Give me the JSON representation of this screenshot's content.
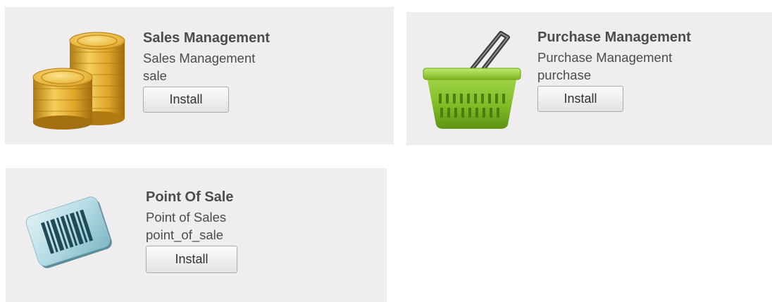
{
  "modules": [
    {
      "title": "Sales Management",
      "description": "Sales Management",
      "technical_name": "sale",
      "install_label": "Install",
      "icon": "gold-coins-icon"
    },
    {
      "title": "Purchase Management",
      "description": "Purchase Management",
      "technical_name": "purchase",
      "install_label": "Install",
      "icon": "shopping-basket-icon"
    },
    {
      "title": "Point Of Sale",
      "description": "Point of Sales",
      "technical_name": "point_of_sale",
      "install_label": "Install",
      "icon": "barcode-card-icon"
    }
  ],
  "colors": {
    "card_background": "#efedee",
    "text": "#4c4c4c",
    "basket_green": "#8cc63f",
    "coin_gold": "#e8b43a"
  }
}
